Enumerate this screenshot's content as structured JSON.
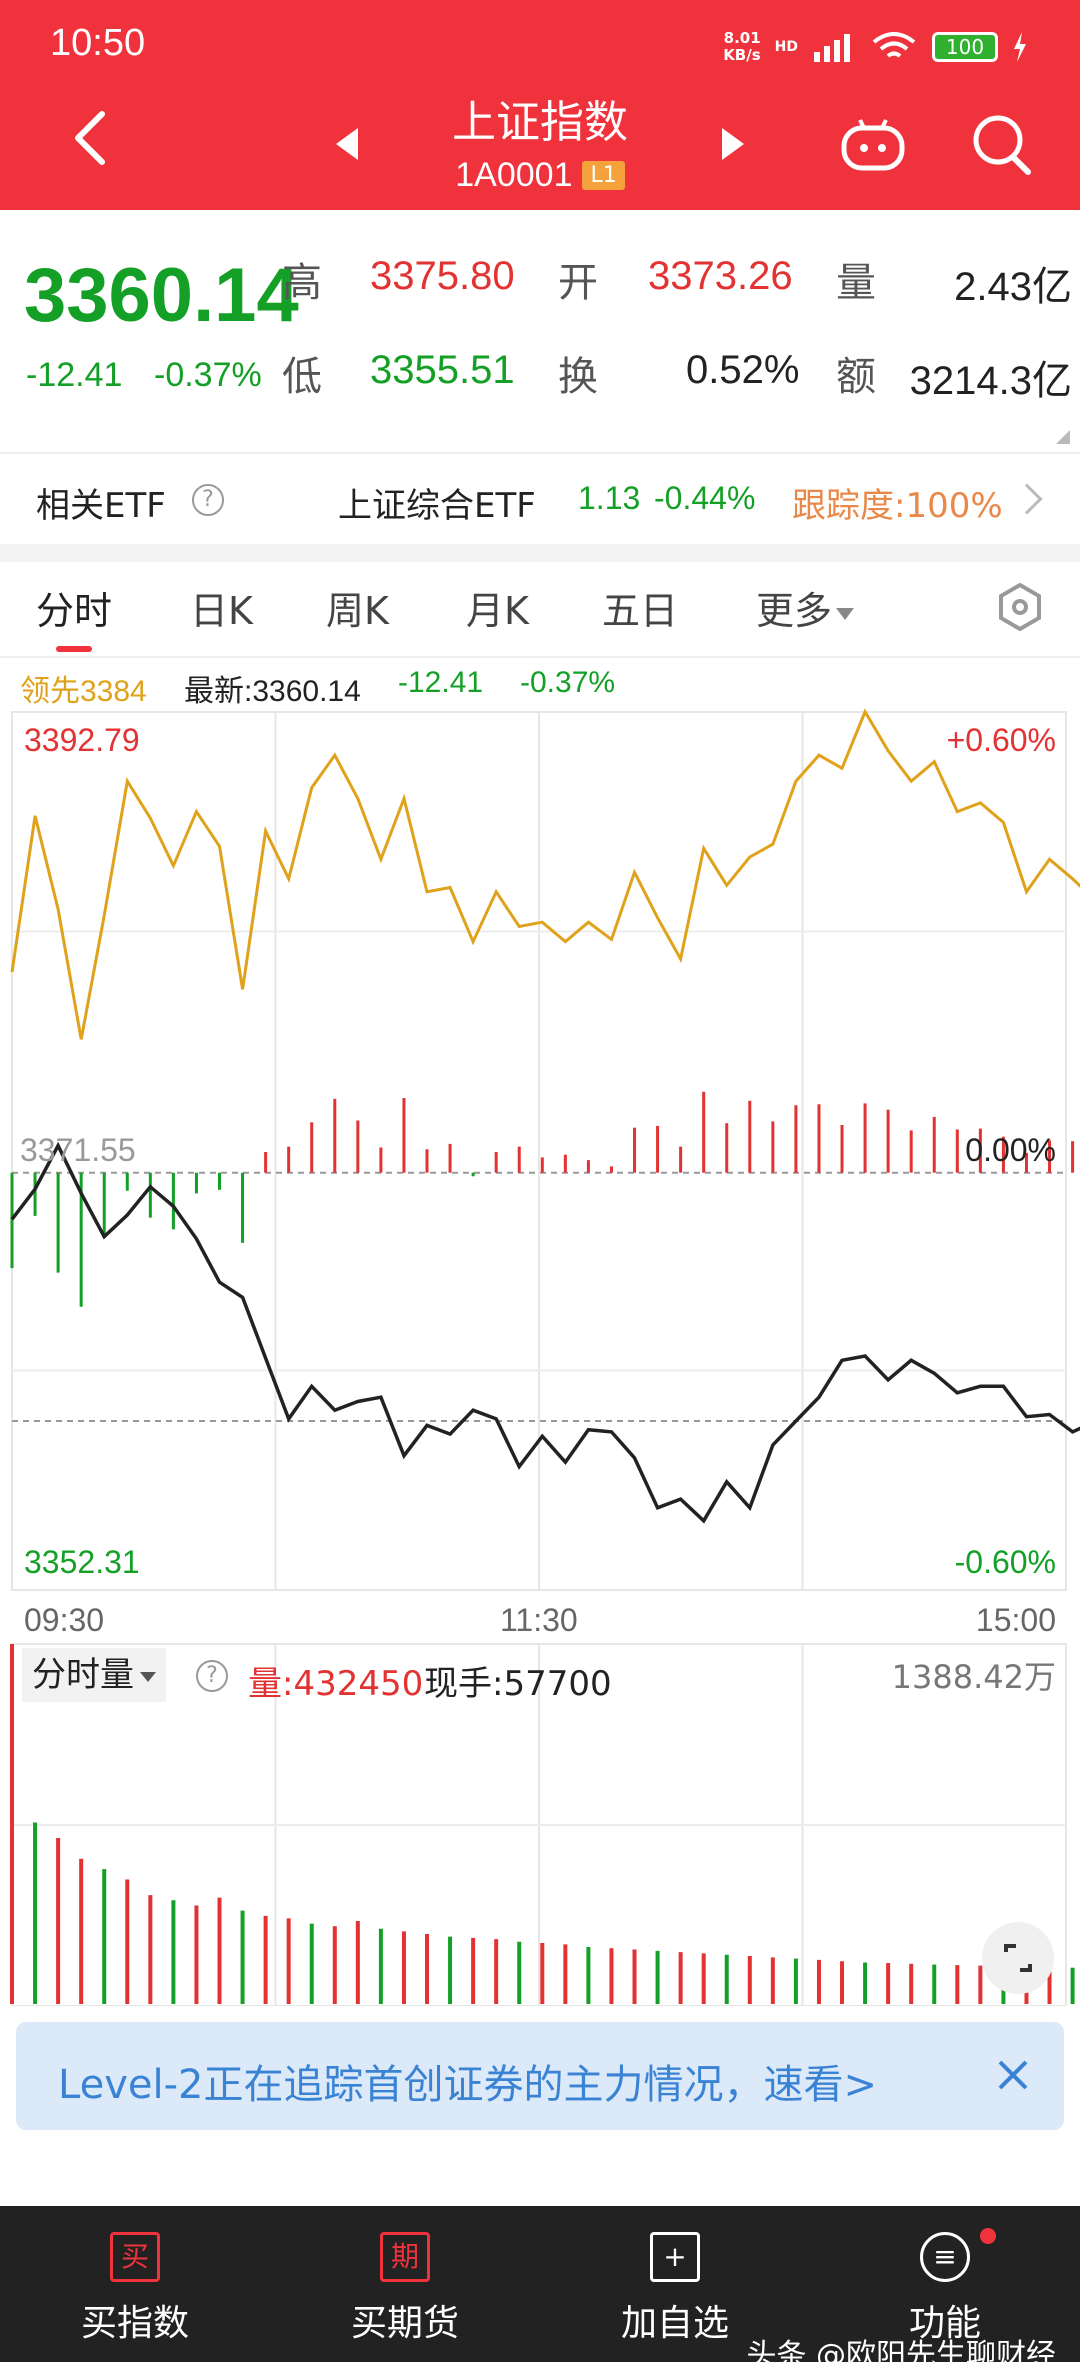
{
  "status_bar": {
    "time": "10:50",
    "net_speed": "8.01",
    "net_unit": "KB/s",
    "hd": "HD",
    "battery": "100"
  },
  "header": {
    "title": "上证指数",
    "code": "1A0001",
    "level": "L1"
  },
  "quote": {
    "price": "3360.14",
    "change": "-12.41",
    "change_pct": "-0.37%",
    "high_label": "高",
    "high": "3375.80",
    "open_label": "开",
    "open": "3373.26",
    "volume_label": "量",
    "volume": "2.43亿",
    "low_label": "低",
    "low": "3355.51",
    "turnover_label": "换",
    "turnover": "0.52%",
    "amount_label": "额",
    "amount": "3214.3亿"
  },
  "etf": {
    "label": "相关ETF",
    "name": "上证综合ETF",
    "price": "1.13",
    "change_pct": "-0.44%",
    "tracking": "跟踪度:100%"
  },
  "tabs": [
    "分时",
    "日K",
    "周K",
    "月K",
    "五日",
    "更多"
  ],
  "info_row": {
    "leading": "领先3384",
    "latest": "最新:3360.14",
    "change": "-12.41",
    "change_pct": "-0.37%"
  },
  "chart_data": {
    "type": "line",
    "y_max": "3392.79",
    "y_min": "3352.31",
    "y_mid": "3371.55",
    "pct_max": "+0.60%",
    "pct_mid": "0.00%",
    "pct_min": "-0.60%",
    "time_labels": [
      "09:30",
      "11:30",
      "15:00"
    ],
    "series": [
      {
        "name": "最新",
        "values": [
          3369.4,
          3370.8,
          3372.8,
          3370.6,
          3368.6,
          3369.6,
          3370.9,
          3370.0,
          3368.5,
          3366.5,
          3365.8,
          3363.0,
          3360.2,
          3361.7,
          3360.6,
          3361.0,
          3361.2,
          3358.5,
          3359.9,
          3359.5,
          3360.6,
          3360.2,
          3358.0,
          3359.4,
          3358.2,
          3359.7,
          3359.6,
          3358.4,
          3356.1,
          3356.5,
          3355.5,
          3357.3,
          3356.1,
          3359.0,
          3360.1,
          3361.2,
          3362.9,
          3363.1,
          3362.0,
          3362.9,
          3362.3,
          3361.4,
          3361.7,
          3361.7,
          3360.3,
          3360.4,
          3359.6,
          3360.1
        ]
      },
      {
        "name": "领先",
        "values": [
          3380.8,
          3388.0,
          3383.7,
          3377.7,
          3383.4,
          3389.6,
          3387.9,
          3385.7,
          3388.2,
          3386.6,
          3380.0,
          3387.3,
          3385.1,
          3389.3,
          3390.8,
          3388.8,
          3386.0,
          3388.8,
          3384.5,
          3384.7,
          3382.2,
          3384.5,
          3382.9,
          3383.1,
          3382.2,
          3383.1,
          3382.3,
          3385.4,
          3383.3,
          3381.4,
          3386.5,
          3384.8,
          3386.1,
          3386.7,
          3389.6,
          3390.8,
          3390.2,
          3392.8,
          3391.0,
          3389.6,
          3390.5,
          3388.2,
          3388.6,
          3387.7,
          3384.5,
          3386.0,
          3385.1,
          3384.1
        ]
      }
    ],
    "volume": {
      "tab": "分时量",
      "label": "量:432450",
      "current": "现手:57700",
      "max_label": "1388.42万",
      "values": [
        1388,
        700,
        640,
        560,
        520,
        480,
        420,
        400,
        380,
        410,
        360,
        340,
        330,
        310,
        300,
        320,
        290,
        280,
        270,
        260,
        255,
        250,
        240,
        235,
        230,
        220,
        215,
        210,
        205,
        200,
        195,
        190,
        185,
        180,
        175,
        170,
        165,
        160,
        158,
        155,
        152,
        150,
        148,
        146,
        144,
        142,
        140,
        138
      ]
    }
  },
  "banner": {
    "text": "Level-2正在追踪首创证券的主力情况，速看>"
  },
  "bottom_nav": [
    {
      "icon": "买",
      "label": "买指数"
    },
    {
      "icon": "期",
      "label": "买期货"
    },
    {
      "icon": "+",
      "label": "加自选"
    },
    {
      "icon": "≡",
      "label": "功能"
    }
  ],
  "watermark": "头条 @欧阳先生聊财经",
  "colors": {
    "brand": "#f0323c",
    "up": "#e23232",
    "down": "#14a026",
    "gold": "#e0a21a"
  }
}
